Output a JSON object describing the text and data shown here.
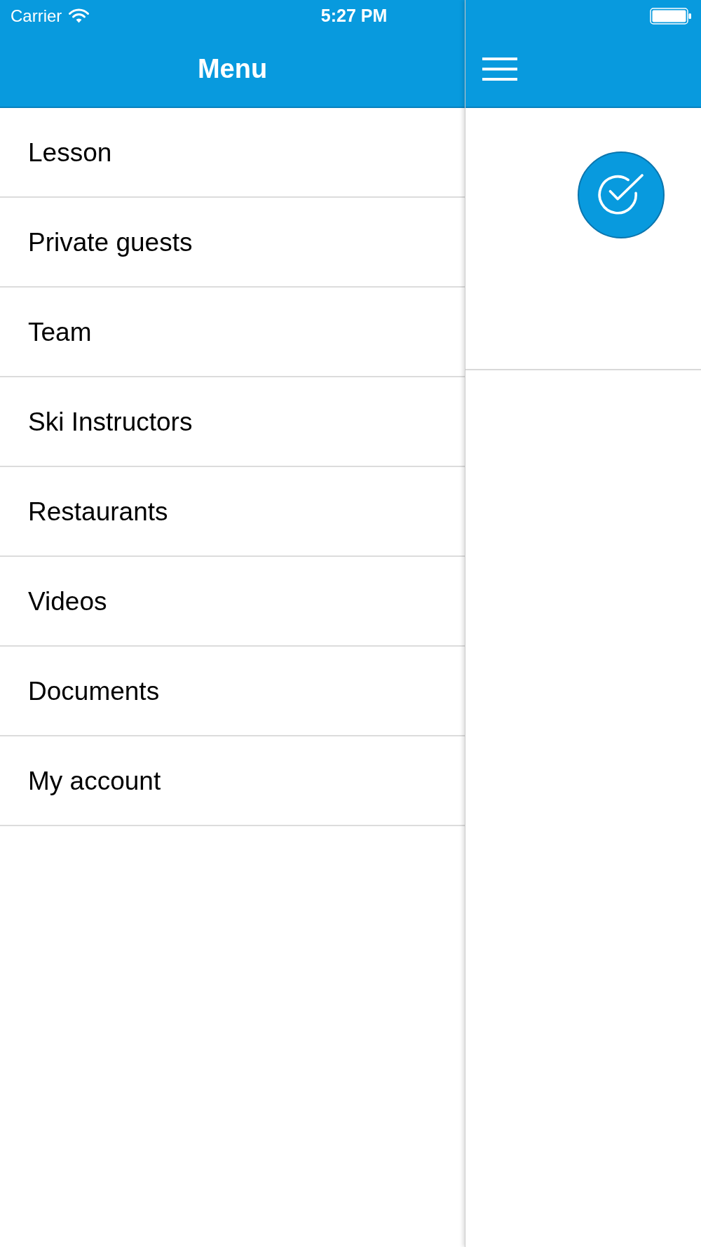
{
  "status_bar": {
    "carrier": "Carrier",
    "time": "5:27 PM"
  },
  "menu": {
    "title": "Menu",
    "items": [
      {
        "label": "Lesson"
      },
      {
        "label": "Private guests"
      },
      {
        "label": "Team"
      },
      {
        "label": "Ski Instructors"
      },
      {
        "label": "Restaurants"
      },
      {
        "label": "Videos"
      },
      {
        "label": "Documents"
      },
      {
        "label": "My account"
      }
    ]
  }
}
